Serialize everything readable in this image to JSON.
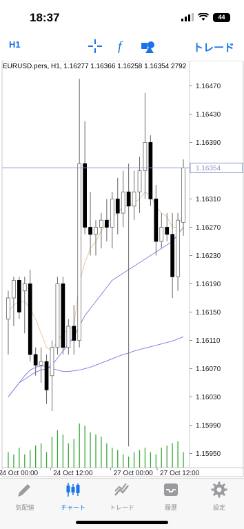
{
  "status": {
    "time": "18:37",
    "battery": "44"
  },
  "toolbar": {
    "timeframe": "H1",
    "crosshair_icon": "crosshair-icon",
    "indicator_icon": "function-icon",
    "objects_icon": "shapes-icon",
    "trade_label": "トレード"
  },
  "chart": {
    "title": "EURUSD.pers, H1, 1.16277 1.16366 1.16258 1.16354 2792",
    "current_price": "1.16354",
    "price_labels": [
      "1.16470",
      "1.16430",
      "1.16390",
      "1.16350",
      "1.16310",
      "1.16270",
      "1.16230",
      "1.16190",
      "1.16150",
      "1.16110",
      "1.16070",
      "1.16030",
      "1.15990",
      "1.15950"
    ],
    "time_labels": [
      "24 Oct 00:00",
      "24 Oct 12:00",
      "27 Oct 00:00",
      "27 Oct 12:00"
    ],
    "colors": {
      "bull": "#ffffff",
      "bear": "#000000",
      "ma_fast": "#e8c8a0",
      "ma_slow": "#8080e0",
      "volume": "#3aa83a",
      "price_line": "#8a9ac8",
      "accent": "#1a73e8"
    }
  },
  "chart_data": {
    "type": "candlestick",
    "symbol": "EURUSD.pers",
    "timeframe": "H1",
    "ylim": [
      1.1593,
      1.1649
    ],
    "candles": [
      {
        "o": 1.1614,
        "h": 1.1618,
        "l": 1.1609,
        "c": 1.1617
      },
      {
        "o": 1.1617,
        "h": 1.162,
        "l": 1.1613,
        "c": 1.16195
      },
      {
        "o": 1.16195,
        "h": 1.162,
        "l": 1.1614,
        "c": 1.1615
      },
      {
        "o": 1.1618,
        "h": 1.162,
        "l": 1.1612,
        "c": 1.1619
      },
      {
        "o": 1.1619,
        "h": 1.1621,
        "l": 1.1608,
        "c": 1.1609
      },
      {
        "o": 1.1609,
        "h": 1.161,
        "l": 1.1606,
        "c": 1.16075
      },
      {
        "o": 1.16075,
        "h": 1.161,
        "l": 1.1605,
        "c": 1.1608
      },
      {
        "o": 1.1608,
        "h": 1.1609,
        "l": 1.1602,
        "c": 1.1604
      },
      {
        "o": 1.1606,
        "h": 1.1611,
        "l": 1.1601,
        "c": 1.161
      },
      {
        "o": 1.161,
        "h": 1.162,
        "l": 1.1609,
        "c": 1.1619
      },
      {
        "o": 1.1619,
        "h": 1.162,
        "l": 1.1609,
        "c": 1.161
      },
      {
        "o": 1.161,
        "h": 1.1614,
        "l": 1.1609,
        "c": 1.1613
      },
      {
        "o": 1.1613,
        "h": 1.1616,
        "l": 1.1609,
        "c": 1.1611
      },
      {
        "o": 1.1611,
        "h": 1.1648,
        "l": 1.161,
        "c": 1.1636
      },
      {
        "o": 1.1636,
        "h": 1.1642,
        "l": 1.1626,
        "c": 1.1627
      },
      {
        "o": 1.1627,
        "h": 1.1632,
        "l": 1.1623,
        "c": 1.1626
      },
      {
        "o": 1.1626,
        "h": 1.1628,
        "l": 1.1623,
        "c": 1.1627
      },
      {
        "o": 1.1627,
        "h": 1.1629,
        "l": 1.1624,
        "c": 1.1628
      },
      {
        "o": 1.1628,
        "h": 1.1631,
        "l": 1.1625,
        "c": 1.1627
      },
      {
        "o": 1.1627,
        "h": 1.1632,
        "l": 1.1624,
        "c": 1.1631
      },
      {
        "o": 1.1631,
        "h": 1.1634,
        "l": 1.1626,
        "c": 1.1629
      },
      {
        "o": 1.1629,
        "h": 1.1635,
        "l": 1.1627,
        "c": 1.1632
      },
      {
        "o": 1.1632,
        "h": 1.1636,
        "l": 1.1596,
        "c": 1.163
      },
      {
        "o": 1.163,
        "h": 1.1635,
        "l": 1.1628,
        "c": 1.1632
      },
      {
        "o": 1.1632,
        "h": 1.1637,
        "l": 1.1629,
        "c": 1.1635
      },
      {
        "o": 1.1635,
        "h": 1.1646,
        "l": 1.1631,
        "c": 1.1639
      },
      {
        "o": 1.1639,
        "h": 1.164,
        "l": 1.163,
        "c": 1.1631
      },
      {
        "o": 1.1631,
        "h": 1.1633,
        "l": 1.1623,
        "c": 1.1625
      },
      {
        "o": 1.1625,
        "h": 1.1629,
        "l": 1.1624,
        "c": 1.1627
      },
      {
        "o": 1.1627,
        "h": 1.1629,
        "l": 1.1625,
        "c": 1.1626
      },
      {
        "o": 1.1626,
        "h": 1.1629,
        "l": 1.1617,
        "c": 1.162
      },
      {
        "o": 1.162,
        "h": 1.1629,
        "l": 1.1618,
        "c": 1.1628
      },
      {
        "o": 1.16277,
        "h": 1.16366,
        "l": 1.16258,
        "c": 1.16354
      }
    ],
    "ma_fast": [
      1.1615,
      1.1616,
      1.16165,
      1.16165,
      1.16155,
      1.1614,
      1.1612,
      1.161,
      1.16095,
      1.1611,
      1.1612,
      1.16125,
      1.1613,
      1.1619,
      1.1622,
      1.1624,
      1.1625,
      1.16265,
      1.16275,
      1.16285,
      1.1629,
      1.163,
      1.163,
      1.16305,
      1.1631,
      1.1632,
      1.16315,
      1.163,
      1.1629,
      1.16285,
      1.1627,
      1.1627,
      1.1629
    ],
    "ma_slow": [
      1.1603,
      1.1604,
      1.1605,
      1.16055,
      1.1606,
      1.16065,
      1.16068,
      1.1607,
      1.16075,
      1.16085,
      1.16095,
      1.16105,
      1.16115,
      1.1613,
      1.16145,
      1.16155,
      1.16165,
      1.16175,
      1.16185,
      1.16195,
      1.162,
      1.16205,
      1.1621,
      1.16215,
      1.1622,
      1.16225,
      1.1623,
      1.16235,
      1.1624,
      1.16245,
      1.1625,
      1.1626,
      1.1627
    ],
    "ma_slow2": [
      1.1603,
      1.1604,
      1.1605,
      1.1606,
      1.16068,
      1.16072,
      1.16074,
      1.16073,
      1.1607,
      1.16068,
      1.16066,
      1.16066,
      1.16067,
      1.16068,
      1.1607,
      1.16072,
      1.16075,
      1.16078,
      1.16081,
      1.16084,
      1.16087,
      1.1609,
      1.16092,
      1.16095,
      1.16097,
      1.16099,
      1.16101,
      1.16103,
      1.16105,
      1.16107,
      1.16109,
      1.16112,
      1.16115
    ],
    "volume": [
      0.35,
      0.3,
      0.45,
      0.3,
      0.4,
      0.5,
      0.55,
      0.35,
      0.7,
      0.85,
      0.75,
      0.55,
      0.65,
      1.0,
      0.95,
      0.8,
      0.75,
      0.7,
      0.55,
      0.45,
      0.4,
      0.3,
      0.25,
      0.35,
      0.4,
      0.45,
      0.35,
      0.3,
      0.45,
      0.5,
      0.55,
      0.6,
      0.35
    ]
  },
  "tabs": [
    {
      "label": "気配値",
      "icon": "quotes-icon"
    },
    {
      "label": "チャート",
      "icon": "chart-icon",
      "active": true
    },
    {
      "label": "トレード",
      "icon": "trade-icon"
    },
    {
      "label": "履歴",
      "icon": "history-icon"
    },
    {
      "label": "設定",
      "icon": "settings-icon"
    }
  ]
}
